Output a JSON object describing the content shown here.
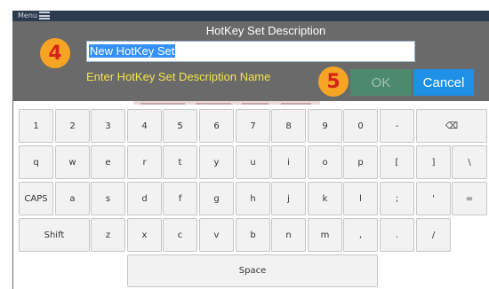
{
  "header": {
    "menu_label": "Menu"
  },
  "dialog": {
    "title": "HotKey Set Description",
    "input_value": "New HotKey Set",
    "hint": "Enter HotKey Set Description Name",
    "ok_label": "OK",
    "cancel_label": "Cancel",
    "step_badges": [
      "4",
      "5"
    ]
  },
  "keyboard": {
    "row1": [
      "1",
      "2",
      "3",
      "4",
      "5",
      "6",
      "7",
      "8",
      "9",
      "0",
      "-",
      "⌫"
    ],
    "row2": [
      "q",
      "w",
      "e",
      "r",
      "t",
      "y",
      "u",
      "i",
      "o",
      "p",
      "[",
      "]",
      "\\"
    ],
    "row3": [
      "CAPS",
      "a",
      "s",
      "d",
      "f",
      "g",
      "h",
      "j",
      "k",
      "l",
      ";",
      "'",
      "="
    ],
    "row4": [
      "Shift",
      "z",
      "x",
      "c",
      "v",
      "b",
      "n",
      "m",
      ",",
      ".",
      "/"
    ],
    "space_label": "Space"
  }
}
